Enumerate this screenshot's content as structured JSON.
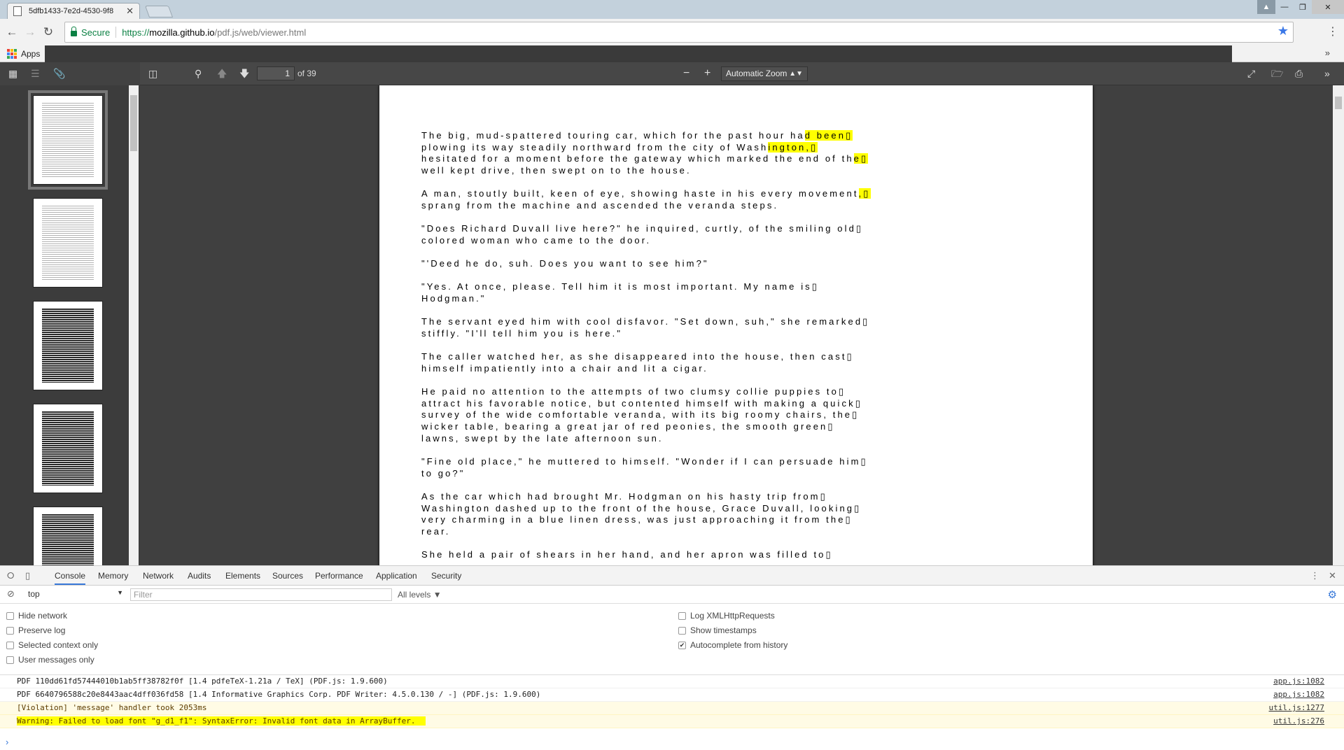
{
  "browser": {
    "tab_title": "5dfb1433-7e2d-4530-9f8",
    "secure_label": "Secure",
    "url_scheme": "https://",
    "url_host": "mozilla.github.io",
    "url_path": "/pdf.js/web/viewer.html",
    "bookmarks_apps": "Apps",
    "bookmarks_more": "»"
  },
  "pdf_toolbar": {
    "page_number": "1",
    "page_count": "of 39",
    "zoom": "Automatic Zoom"
  },
  "pdf_page": {
    "paragraphs": [
      [
        "The big, mud-spattered touring car, which for the past hour ha",
        "d been▯",
        "",
        "plowing its way steadily northward from the city of Wash",
        "ington,▯",
        "",
        "hesitated for a moment before the gateway which marked the end of th",
        "e▯",
        "",
        "well kept drive, then swept on to the house."
      ],
      [
        "A man, stoutly built, keen of eye, showing haste in his every movement",
        ",▯",
        "",
        "sprang from the machine and ascended the veranda steps."
      ],
      [
        "\"Does Richard Duvall live here?\" he inquired, curtly, of the smiling old▯",
        "colored woman who came to the door."
      ],
      [
        "\"'Deed he do, suh. Does you want to see him?\""
      ],
      [
        "\"Yes. At once, please. Tell him it is most important. My name is▯",
        "Hodgman.\""
      ],
      [
        "The servant eyed him with cool disfavor. \"Set down, suh,\" she remarked▯",
        "stiffly. \"I'll tell him you is here.\""
      ],
      [
        "The caller watched her, as she disappeared into the house, then cast▯",
        "himself impatiently into a chair and lit a cigar."
      ],
      [
        "He paid no attention to the attempts of two clumsy collie puppies to▯",
        "attract his favorable notice, but contented himself with making a quick▯",
        "survey of the wide comfortable veranda, with its big roomy chairs, the▯",
        "wicker table, bearing a great jar of red peonies, the smooth green▯",
        "lawns, swept by the late afternoon sun."
      ],
      [
        "\"Fine old place,\" he muttered to himself. \"Wonder if I can persuade him▯",
        "to go?\""
      ],
      [
        "As the car which had brought Mr. Hodgman on his hasty trip from▯",
        "Washington dashed up to the front of the house, Grace Duvall, looking▯",
        "very charming in a blue linen dress, was just approaching it from the▯",
        "rear."
      ],
      [
        "She held a pair of shears in her hand, and her apron was filled to▯"
      ]
    ]
  },
  "devtools": {
    "tabs": [
      "Console",
      "Memory",
      "Network",
      "Audits",
      "Elements",
      "Sources",
      "Performance",
      "Application",
      "Security"
    ],
    "context": "top",
    "filter_placeholder": "Filter",
    "levels": "All levels",
    "options_left": [
      {
        "label": "Hide network",
        "checked": false
      },
      {
        "label": "Preserve log",
        "checked": false
      },
      {
        "label": "Selected context only",
        "checked": false
      },
      {
        "label": "User messages only",
        "checked": false
      }
    ],
    "options_right": [
      {
        "label": "Log XMLHttpRequests",
        "checked": false
      },
      {
        "label": "Show timestamps",
        "checked": false
      },
      {
        "label": "Autocomplete from history",
        "checked": true
      }
    ],
    "messages": [
      {
        "text": "PDF 110dd61fd57444010b1ab5ff38782f0f [1.4 pdfeTeX-1.21a / TeX] (PDF.js: 1.9.600)",
        "source": "app.js:1082",
        "level": "log"
      },
      {
        "text": "PDF 6640796588c20e8443aac4dff036fd58 [1.4 Informative Graphics Corp. PDF Writer: 4.5.0.130 / -] (PDF.js: 1.9.600)",
        "source": "app.js:1082",
        "level": "log"
      },
      {
        "text": "[Violation] 'message' handler took 2053ms",
        "source": "util.js:1277",
        "level": "warn"
      },
      {
        "text": "Warning: Failed to load font \"g_d1_f1\": SyntaxError: Invalid font data in ArrayBuffer.",
        "source": "util.js:276",
        "level": "warn-highlight"
      }
    ]
  }
}
